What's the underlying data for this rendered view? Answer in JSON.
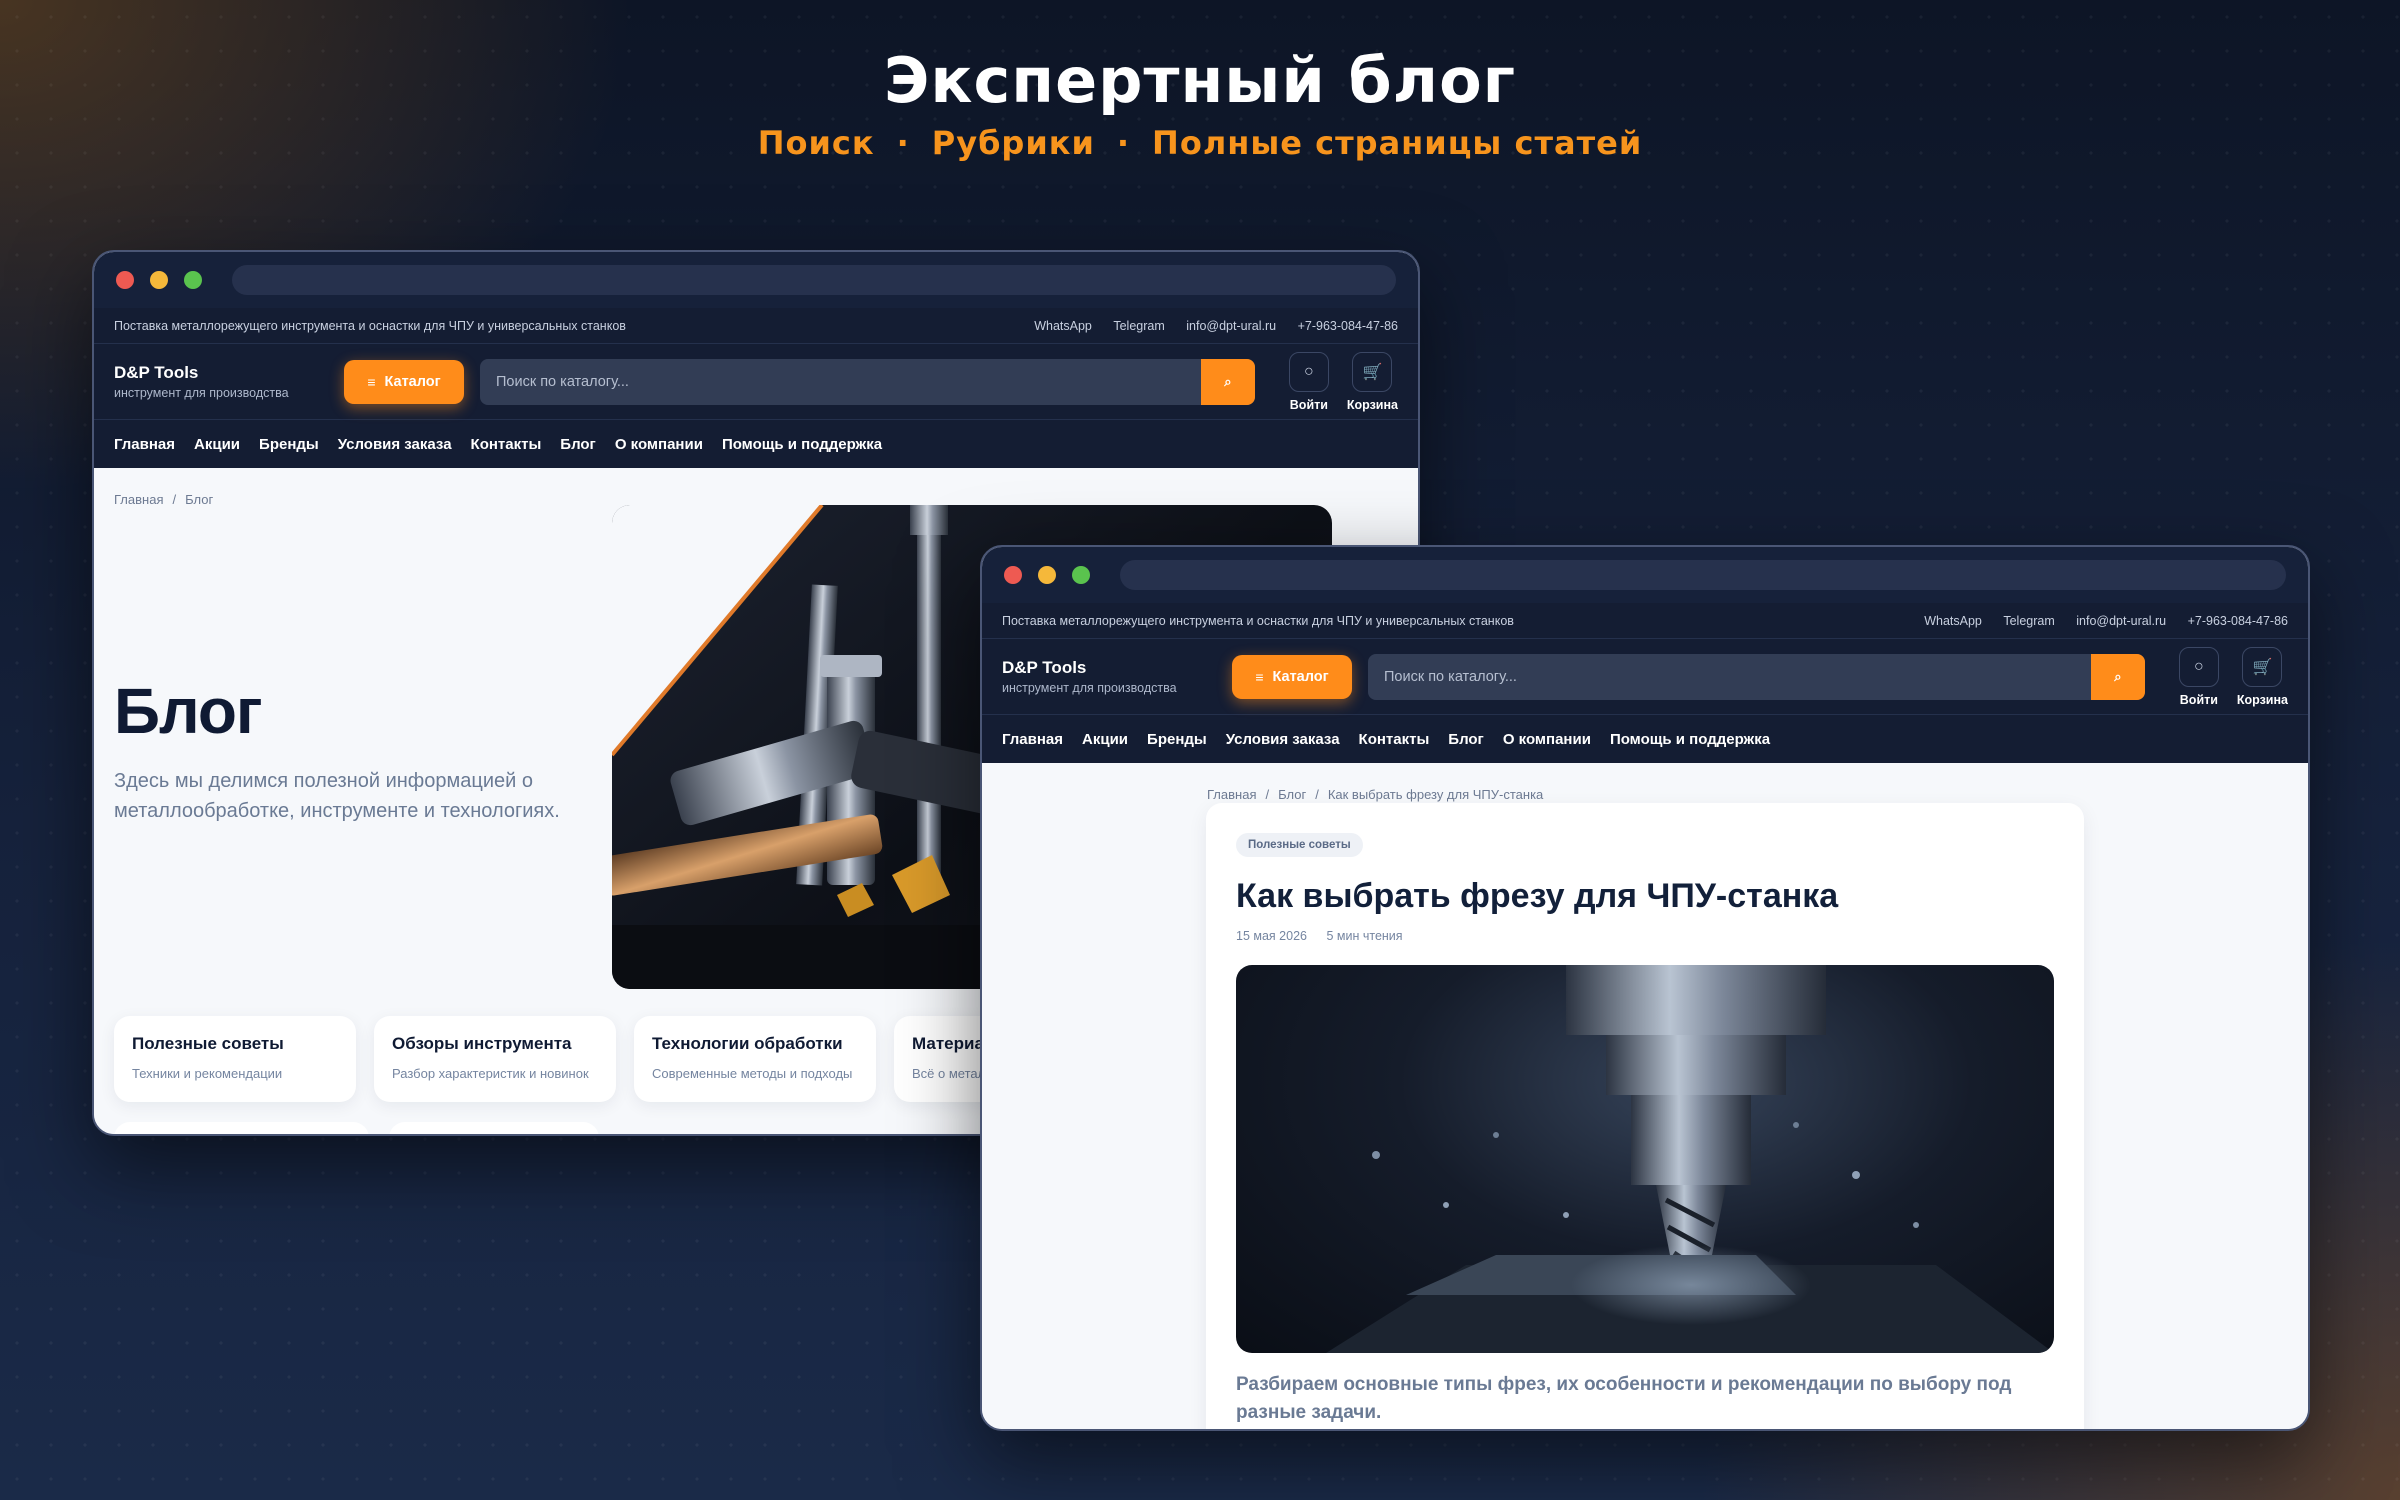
{
  "hero": {
    "title": "Экспертный блог",
    "features": [
      "Поиск",
      "Рубрики",
      "Полные страницы статей"
    ],
    "separator": "·"
  },
  "site": {
    "topbar_text": "Поставка металлорежущего инструмента и оснастки для ЧПУ и универсальных станков",
    "contacts": [
      "WhatsApp",
      "Telegram",
      "info@dpt-ural.ru",
      "+7-963-084-47-86"
    ],
    "brand": "D&P Tools",
    "tagline": "инструмент для производства",
    "catalog_label": "Каталог",
    "search_placeholder": "Поиск по каталогу...",
    "login_label": "Войти",
    "cart_label": "Корзина",
    "nav": [
      "Главная",
      "Акции",
      "Бренды",
      "Условия заказа",
      "Контакты",
      "Блог",
      "О компании",
      "Помощь и поддержка"
    ]
  },
  "blog_page": {
    "breadcrumb": [
      "Главная",
      "Блог"
    ],
    "title": "Блог",
    "description": "Здесь мы делимся полезной информацией о металлообработке, инструменте и технологиях.",
    "rubrics": [
      {
        "title": "Полезные советы",
        "desc": "Техники и рекомендации"
      },
      {
        "title": "Обзоры инструмента",
        "desc": "Разбор характеристик и новинок"
      },
      {
        "title": "Технологии обработки",
        "desc": "Современные методы и подходы"
      },
      {
        "title": "Материа",
        "desc": "Всё о метал"
      }
    ]
  },
  "article_page": {
    "breadcrumb": [
      "Главная",
      "Блог",
      "Как выбрать фрезу для ЧПУ-станка"
    ],
    "tag": "Полезные советы",
    "title": "Как выбрать фрезу для ЧПУ-станка",
    "date": "15 мая 2026",
    "read_time": "5 мин чтения",
    "lead": "Разбираем основные типы фрез, их особенности и рекомендации по выбору под разные задачи."
  },
  "colors": {
    "accent": "#ff8c1a",
    "header_bg": "#141d33",
    "hero_subtitle": "#f7941d"
  },
  "icons": {
    "menu": "menu-icon",
    "search": "search-icon",
    "user": "user-icon",
    "cart": "cart-icon"
  }
}
